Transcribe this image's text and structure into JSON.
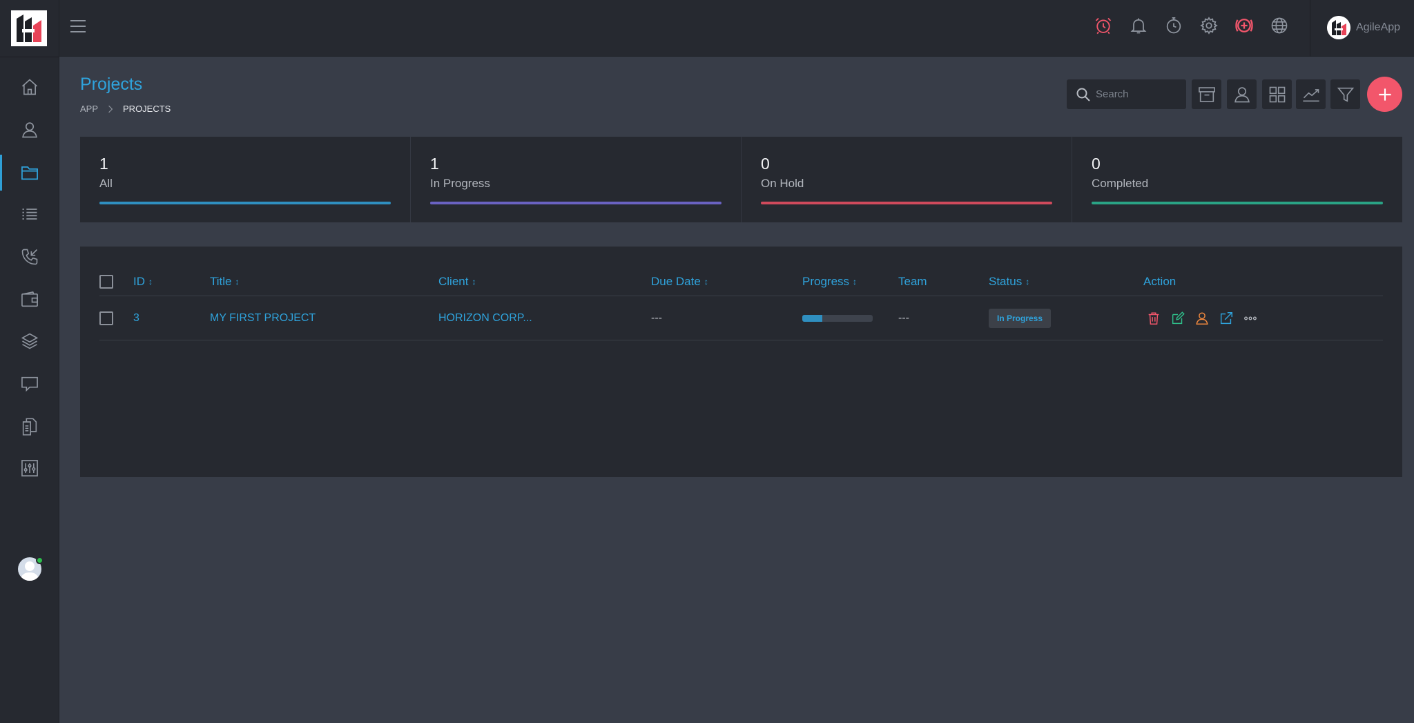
{
  "app": {
    "user_name": "AgileApp"
  },
  "sidebar": {
    "items": [
      {
        "name": "home"
      },
      {
        "name": "clients"
      },
      {
        "name": "projects",
        "active": true
      },
      {
        "name": "tasks"
      },
      {
        "name": "leads"
      },
      {
        "name": "sales"
      },
      {
        "name": "products"
      },
      {
        "name": "tickets"
      },
      {
        "name": "documents"
      },
      {
        "name": "settings"
      }
    ]
  },
  "topbar": {
    "icons": [
      "alarm-clock-icon",
      "bell-icon",
      "timer-icon",
      "gear-icon",
      "add-circle-icon",
      "globe-icon"
    ]
  },
  "page": {
    "title": "Projects",
    "breadcrumb": {
      "root": "APP",
      "current": "PROJECTS"
    }
  },
  "search": {
    "placeholder": "Search"
  },
  "stats": [
    {
      "count": "1",
      "label": "All",
      "color": "#2f8fc0"
    },
    {
      "count": "1",
      "label": "In Progress",
      "color": "#6a62c2"
    },
    {
      "count": "0",
      "label": "On Hold",
      "color": "#d04a5c"
    },
    {
      "count": "0",
      "label": "Completed",
      "color": "#2aa385"
    }
  ],
  "table": {
    "columns": {
      "id": "ID",
      "title": "Title",
      "client": "Client",
      "due_date": "Due Date",
      "progress": "Progress",
      "team": "Team",
      "status": "Status",
      "action": "Action"
    },
    "rows": [
      {
        "id": "3",
        "title": "MY FIRST PROJECT",
        "client": "HORIZON CORP...",
        "due_date": "---",
        "progress": 0.28,
        "team": "---",
        "status": "In Progress"
      }
    ]
  },
  "colors": {
    "accent": "#2fa3dc",
    "danger": "#f2566b",
    "edit": "#2fbf8a",
    "assign": "#f0883e"
  }
}
